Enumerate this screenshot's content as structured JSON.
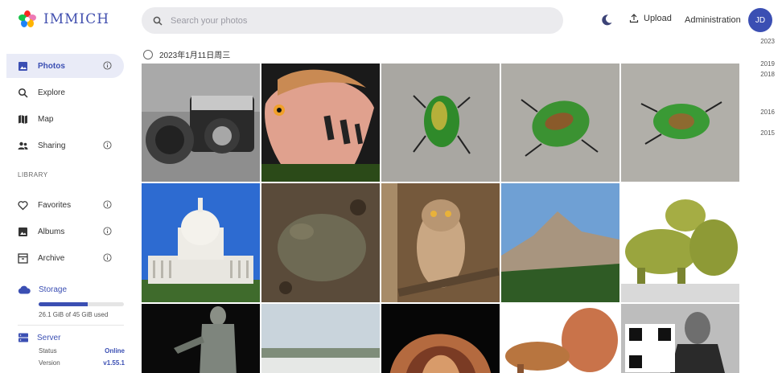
{
  "app": {
    "name": "IMMICH"
  },
  "search": {
    "placeholder": "Search your photos"
  },
  "header": {
    "upload_label": "Upload",
    "admin_label": "Administration",
    "avatar_initials": "JD"
  },
  "sidebar": {
    "items": [
      {
        "label": "Photos",
        "icon": "photos-icon",
        "active": true,
        "info": true
      },
      {
        "label": "Explore",
        "icon": "search-icon",
        "active": false,
        "info": false
      },
      {
        "label": "Map",
        "icon": "map-icon",
        "active": false,
        "info": false
      },
      {
        "label": "Sharing",
        "icon": "people-icon",
        "active": false,
        "info": true
      }
    ],
    "library_label": "LIBRARY",
    "library_items": [
      {
        "label": "Favorites",
        "icon": "heart-icon",
        "info": true
      },
      {
        "label": "Albums",
        "icon": "album-icon",
        "info": true
      },
      {
        "label": "Archive",
        "icon": "archive-icon",
        "info": true
      }
    ],
    "storage": {
      "label": "Storage",
      "usage_text": "26.1 GiB of 45 GiB used",
      "used_fraction": 0.58
    },
    "server": {
      "label": "Server",
      "status_label": "Status",
      "status_value": "Online",
      "version_label": "Version",
      "version_value": "v1.55.1"
    }
  },
  "main": {
    "date_group": "2023年1月11日周三"
  },
  "timeline": {
    "years": [
      "2023",
      "2019",
      "2018",
      "2016",
      "2015"
    ]
  },
  "photos": [
    {
      "subject": "camera"
    },
    {
      "subject": "fish"
    },
    {
      "subject": "beetle"
    },
    {
      "subject": "beetle"
    },
    {
      "subject": "beetle"
    },
    {
      "subject": "capitol"
    },
    {
      "subject": "toad"
    },
    {
      "subject": "owl"
    },
    {
      "subject": "mountain"
    },
    {
      "subject": "dinosaur"
    },
    {
      "subject": "statue"
    },
    {
      "subject": "landscape"
    },
    {
      "subject": "shell"
    },
    {
      "subject": "dinosaur"
    },
    {
      "subject": "portrait"
    }
  ],
  "colors": {
    "accent": "#3b4fb3",
    "search_bg": "#ebebee",
    "active_bg": "#e9ebf7"
  }
}
